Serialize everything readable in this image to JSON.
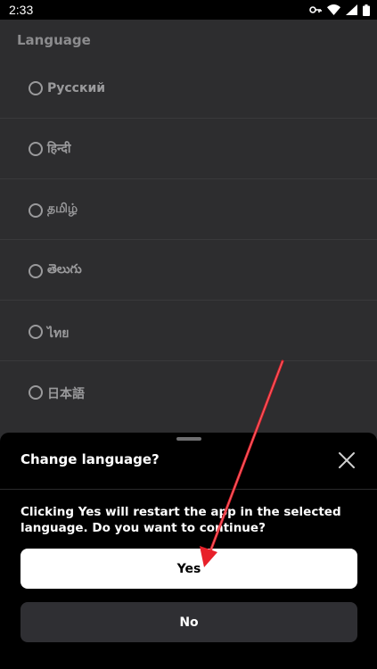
{
  "status_bar": {
    "time": "2:33"
  },
  "page": {
    "title": "Language",
    "languages": [
      {
        "label": "Русский"
      },
      {
        "label": "हिन्दी"
      },
      {
        "label": "தமிழ்"
      },
      {
        "label": "తెలుగు"
      },
      {
        "label": "ไทย"
      },
      {
        "label": "日本語"
      }
    ]
  },
  "dialog": {
    "title": "Change language?",
    "message": "Clicking Yes will restart the app in the selected language. Do you want to continue?",
    "yes_label": "Yes",
    "no_label": "No"
  },
  "colors": {
    "annotation_arrow": "#e8202a",
    "sheet_bg": "#000000",
    "page_bg": "#2d2d2f"
  }
}
